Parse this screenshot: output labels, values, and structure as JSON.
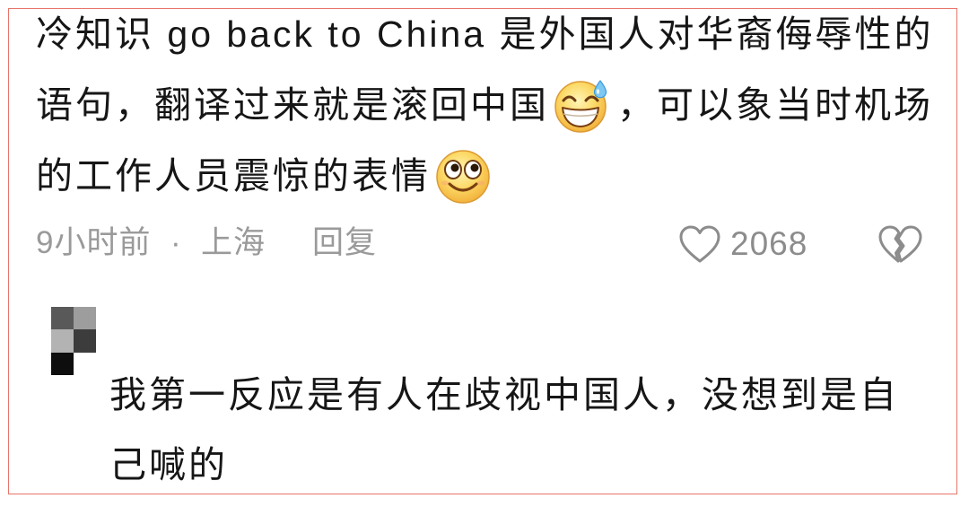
{
  "comment": {
    "lines": [
      {
        "text": "冷知识 go back to China 是外国人对华裔侮辱性的"
      },
      {
        "text_before": "语句，翻译过来就是滚回中国",
        "emoji": "grinning-face-with-sweat-icon",
        "text_after": "，可以象当时机场"
      },
      {
        "text_before": "的工作人员震惊的表情",
        "emoji": "smiling-face-icon"
      }
    ],
    "time": "9小时前",
    "separator": "·",
    "location": "上海",
    "reply_label": "回复",
    "like_icon": "heart-icon",
    "like_count": "2068",
    "dislike_icon": "broken-heart-icon"
  },
  "reply": {
    "lines": [
      "我第一反应是有人在歧视中国人，没想到是自",
      "己喊的"
    ]
  },
  "colors": {
    "text": "#161616",
    "meta_text": "#9a9a9a",
    "icon": "#8c8c8c",
    "frame_border": "#e8756a",
    "background": "#ffffff"
  }
}
